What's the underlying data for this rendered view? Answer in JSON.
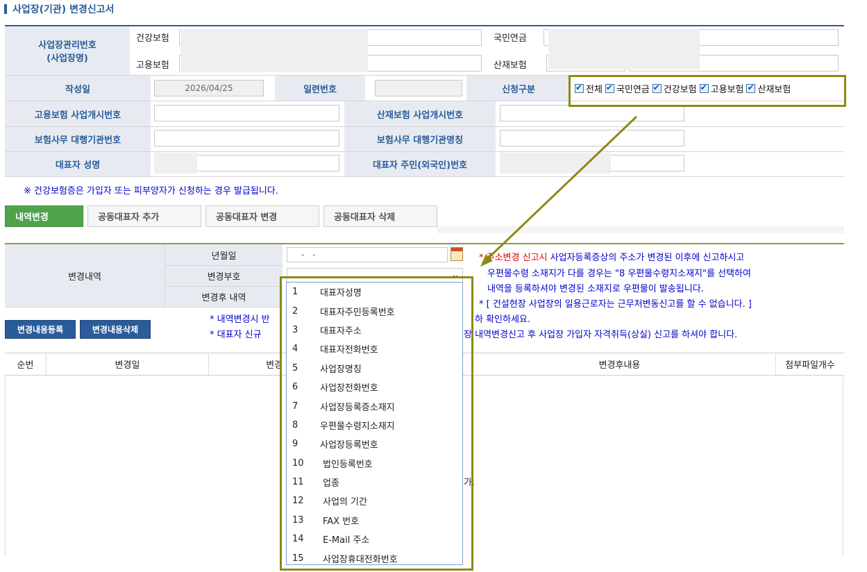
{
  "page_title": "사업장(기관) 변경신고서",
  "header": {
    "biz_mgmt_label_line1": "사업장관리번호",
    "biz_mgmt_label_line2": "(사업장명)",
    "health": "건강보험",
    "pension": "국민연금",
    "employment": "고용보험",
    "accident": "산재보험"
  },
  "row_written": {
    "label": "작성일",
    "date": "2026/04/25",
    "serial_label": "일련번호",
    "apply_label": "신청구분"
  },
  "apply_checks": [
    "전체",
    "국민연금",
    "건강보험",
    "고용보험",
    "산재보험"
  ],
  "row_emp_start": {
    "label": "고용보험 사업개시번호",
    "label2": "산재보험 사업개시번호"
  },
  "row_agency": {
    "label": "보험사무 대행기관번호",
    "label2": "보험사무 대행기관명칭"
  },
  "row_rep": {
    "label": "대표자 성명",
    "label2": "대표자 주민(외국인)번호"
  },
  "notice": "※ 건강보험증은 가입자 또는 피부양자가 신청하는 경우 발급됩니다.",
  "tabs": [
    "내역변경",
    "공동대표자 추가",
    "공동대표자 변경",
    "공동대표자 삭제"
  ],
  "change_section": {
    "label": "변경내역",
    "ym_label": "년월일",
    "ym_value": "-   -",
    "code_label": "변경부호",
    "after_label": "변경후 내역"
  },
  "info_lines": {
    "line1_red": "* 주소변경 신고시",
    "line1_blue": " 사업자등록증상의 주소가 변경된 이후에 신고하시고",
    "line2": "우편물수령 소재지가 다를 경우는 \"8 우편물수령지소재지\"를 선택하여",
    "line3": "내역을 등록하셔야 변경된 소재지로 우편물이 발송됩니다.",
    "line4": "* [ 건설현장 사업장의 일용근로자는 근무처변동신고를 할 수 없습니다. ]",
    "line5_left": "* 내역변경시 반",
    "line5_right": "하 확인하세요.",
    "line6_left": "* 대표자 신규  ",
    "line6_right": "장 내역변경신고 후 사업장 가입자 자격취득(상실) 신고를 하셔야 합니다."
  },
  "buttons": {
    "register": "변경내용등록",
    "delete": "변경내용삭제"
  },
  "grid_headers": [
    "순번",
    "변경일",
    "변경",
    "변경후내용",
    "첨부파일개수"
  ],
  "grid_fragment": "가.",
  "dropdown_options": [
    {
      "n": "1",
      "label": "대표자성명"
    },
    {
      "n": "2",
      "label": "대표자주민등록번호"
    },
    {
      "n": "3",
      "label": "대표자주소"
    },
    {
      "n": "4",
      "label": "대표자전화번호"
    },
    {
      "n": "5",
      "label": "사업장명칭"
    },
    {
      "n": "6",
      "label": "사업장전화번호"
    },
    {
      "n": "7",
      "label": "사업장등록증소재지"
    },
    {
      "n": "8",
      "label": "우편물수령지소재지"
    },
    {
      "n": "9",
      "label": "사업장등록번호"
    },
    {
      "n": "10",
      "label": "법인등록번호"
    },
    {
      "n": "11",
      "label": "업종"
    },
    {
      "n": "12",
      "label": "사업의 기간"
    },
    {
      "n": "13",
      "label": "FAX 번호"
    },
    {
      "n": "14",
      "label": "E-Mail 주소"
    },
    {
      "n": "15",
      "label": "사업장휴대전화번호"
    }
  ],
  "colors": {
    "accent": "#2a5c9a",
    "tab_active": "#4ea34b",
    "highlight": "#8a8a14"
  }
}
